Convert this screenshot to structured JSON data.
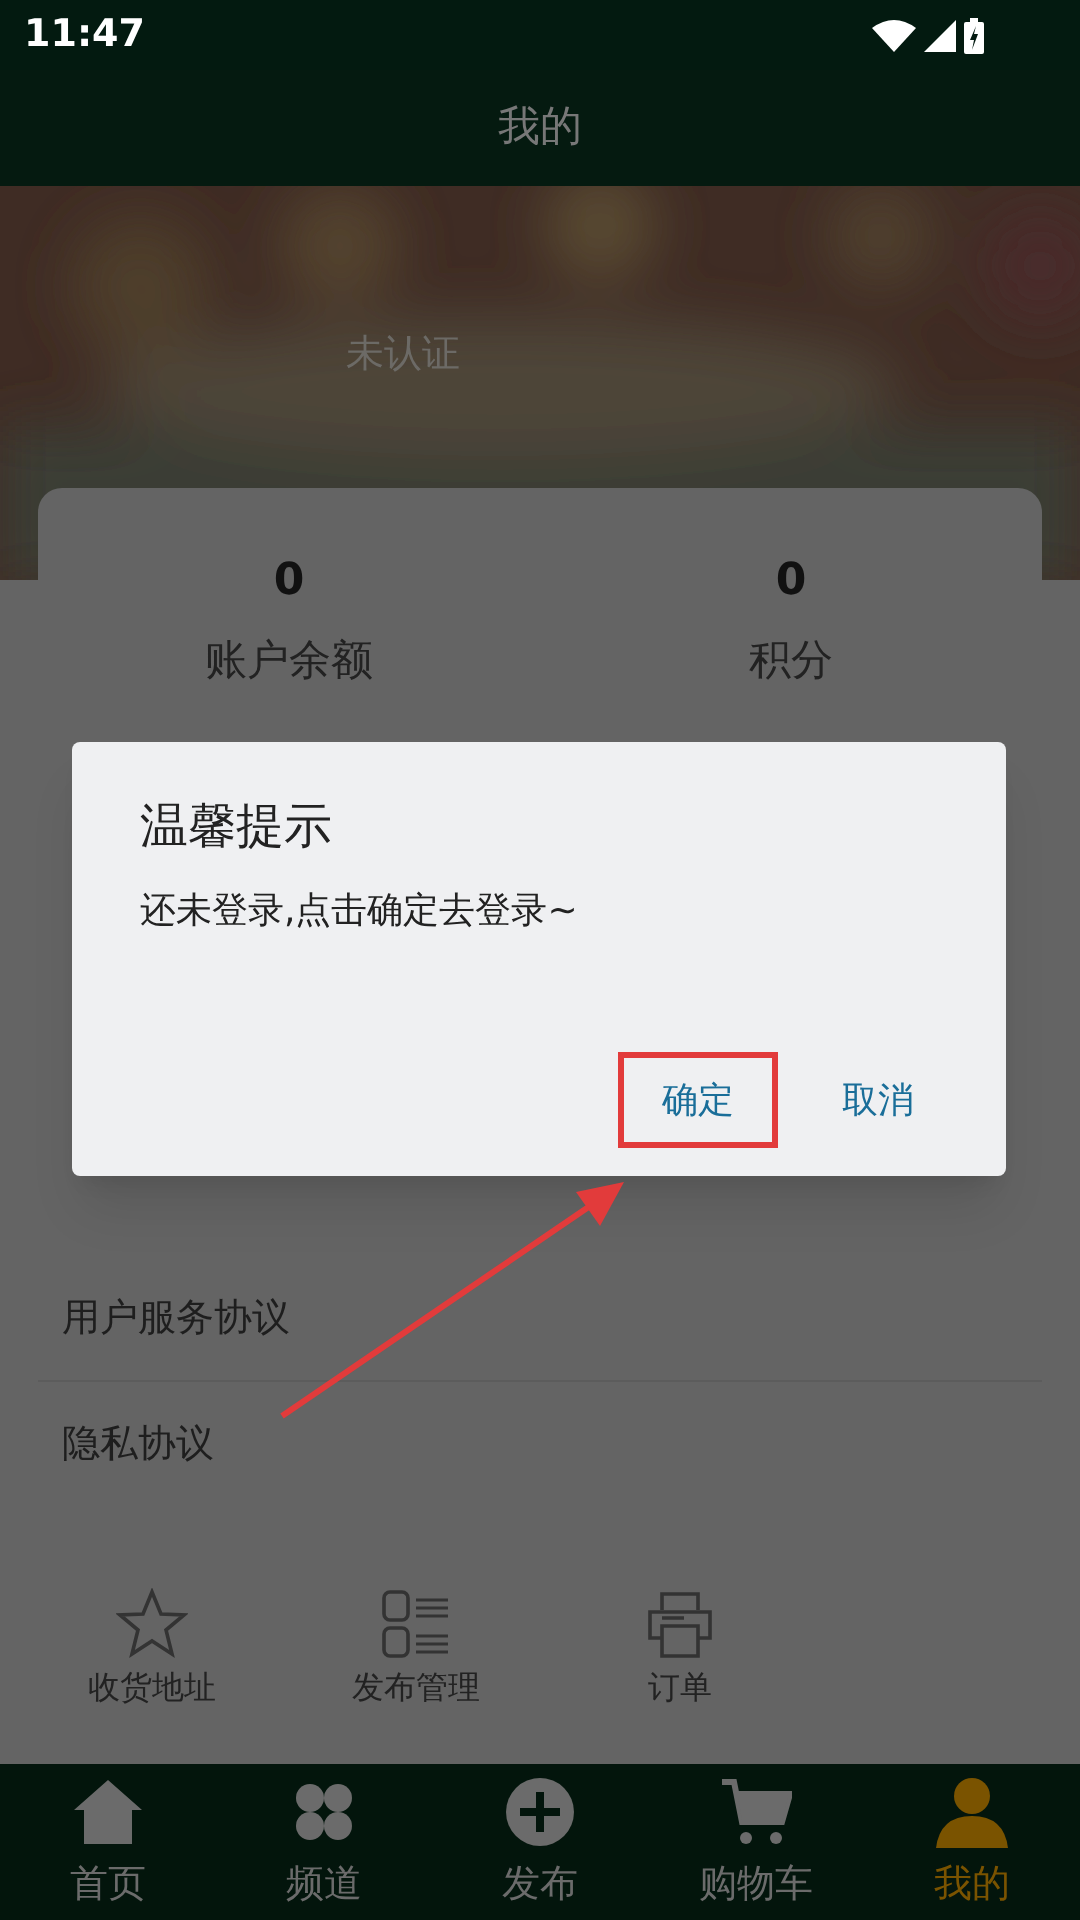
{
  "status_bar": {
    "time": "11:47"
  },
  "header": {
    "title": "我的"
  },
  "profile": {
    "status": "未认证"
  },
  "stats": [
    {
      "value": "0",
      "label": "账户余额"
    },
    {
      "value": "0",
      "label": "积分"
    }
  ],
  "menu": [
    {
      "label": "用户服务协议"
    },
    {
      "label": "隐私协议"
    }
  ],
  "shortcuts": [
    {
      "kind": "star",
      "label": "收货地址"
    },
    {
      "kind": "list",
      "label": "发布管理"
    },
    {
      "kind": "printer",
      "label": "订单"
    }
  ],
  "dialog": {
    "title": "温馨提示",
    "message": "还未登录,点击确定去登录~",
    "buttons": [
      {
        "label": "确定",
        "highlighted": true
      },
      {
        "label": "取消",
        "highlighted": false
      }
    ]
  },
  "tabs": [
    {
      "kind": "home",
      "label": "首页",
      "selected": false
    },
    {
      "kind": "channel",
      "label": "频道",
      "selected": false
    },
    {
      "kind": "plus",
      "label": "发布",
      "selected": false
    },
    {
      "kind": "cart",
      "label": "购物车",
      "selected": false
    },
    {
      "kind": "user",
      "label": "我的",
      "selected": true
    }
  ]
}
